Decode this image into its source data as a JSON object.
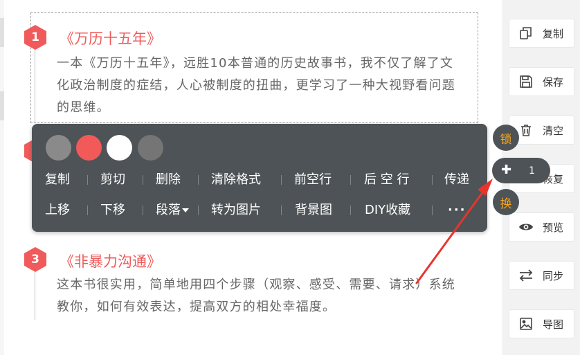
{
  "items": [
    {
      "number": "1",
      "title": "《万历十五年》",
      "body": "一本《万历十五年》，远胜10本普通的历史故事书，我不仅了解了文化政治制度的症结，人心被制度的扭曲，更学习了一种大视野看问题的思维。"
    },
    {
      "number": "3",
      "title": "《非暴力沟通》",
      "body": "这本书很实用，简单地用四个步骤（观察、感受、需要、请求）系统教你，如何有效表达，提高双方的相处幸福度。"
    }
  ],
  "toolbar": {
    "colors": [
      "#8a8a8a",
      "#f25a5a",
      "#ffffff",
      "#757575"
    ],
    "row1": [
      "复制",
      "剪切",
      "删除",
      "清除格式",
      "前空行",
      "后 空 行",
      "传递"
    ],
    "row2": [
      "上移",
      "下移",
      "段落",
      "转为图片",
      "背景图",
      "DIY收藏",
      "···"
    ]
  },
  "floating": {
    "lock": "锁",
    "plus": "✚",
    "count": "1",
    "swap": "换"
  },
  "sidebar": [
    {
      "label": "复制",
      "icon": "copy-icon"
    },
    {
      "label": "保存",
      "icon": "save-icon"
    },
    {
      "label": "清空",
      "icon": "trash-icon"
    },
    {
      "label": "恢复",
      "icon": "restore-icon"
    },
    {
      "label": "预览",
      "icon": "eye-icon"
    },
    {
      "label": "同步",
      "icon": "sync-icon"
    },
    {
      "label": "导图",
      "icon": "image-icon"
    }
  ],
  "accent_color": "#f05a5a",
  "arrow_color": "#e8342c"
}
